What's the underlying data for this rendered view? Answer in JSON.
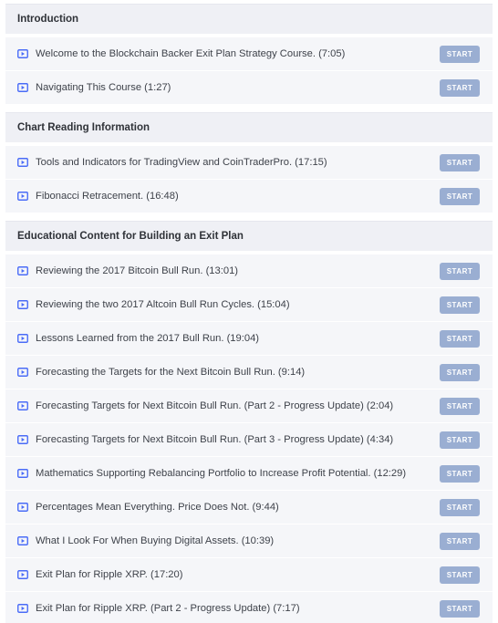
{
  "colors": {
    "section_bg": "#eff0f5",
    "row_bg": "#f5f6f9",
    "button_bg": "#9aaed2",
    "icon": "#4a6cf7"
  },
  "sections": [
    {
      "title": "Introduction",
      "lectures": [
        {
          "title": "Welcome to the Blockchain Backer Exit Plan Strategy Course.  (7:05)",
          "button": "START"
        },
        {
          "title": "Navigating This Course  (1:27)",
          "button": "START"
        }
      ]
    },
    {
      "title": "Chart Reading Information",
      "lectures": [
        {
          "title": "Tools and Indicators for TradingView and CoinTraderPro.  (17:15)",
          "button": "START"
        },
        {
          "title": "Fibonacci Retracement.  (16:48)",
          "button": "START"
        }
      ]
    },
    {
      "title": "Educational Content for Building an Exit Plan",
      "lectures": [
        {
          "title": "Reviewing the 2017 Bitcoin Bull Run.  (13:01)",
          "button": "START"
        },
        {
          "title": "Reviewing the two 2017 Altcoin Bull Run Cycles.  (15:04)",
          "button": "START"
        },
        {
          "title": "Lessons Learned from the 2017 Bull Run.  (19:04)",
          "button": "START"
        },
        {
          "title": "Forecasting the Targets for the Next Bitcoin Bull Run.  (9:14)",
          "button": "START"
        },
        {
          "title": "Forecasting Targets for Next Bitcoin Bull Run. (Part 2 - Progress Update)  (2:04)",
          "button": "START"
        },
        {
          "title": "Forecasting Targets for Next Bitcoin Bull Run. (Part 3 - Progress Update)  (4:34)",
          "button": "START"
        },
        {
          "title": "Mathematics Supporting Rebalancing Portfolio to Increase Profit Potential.  (12:29)",
          "button": "START"
        },
        {
          "title": "Percentages Mean Everything. Price Does Not.  (9:44)",
          "button": "START"
        },
        {
          "title": "What I Look For When Buying Digital Assets.  (10:39)",
          "button": "START"
        },
        {
          "title": "Exit Plan for Ripple XRP.  (17:20)",
          "button": "START"
        },
        {
          "title": "Exit Plan for Ripple XRP. (Part 2 - Progress Update)  (7:17)",
          "button": "START"
        }
      ]
    }
  ]
}
